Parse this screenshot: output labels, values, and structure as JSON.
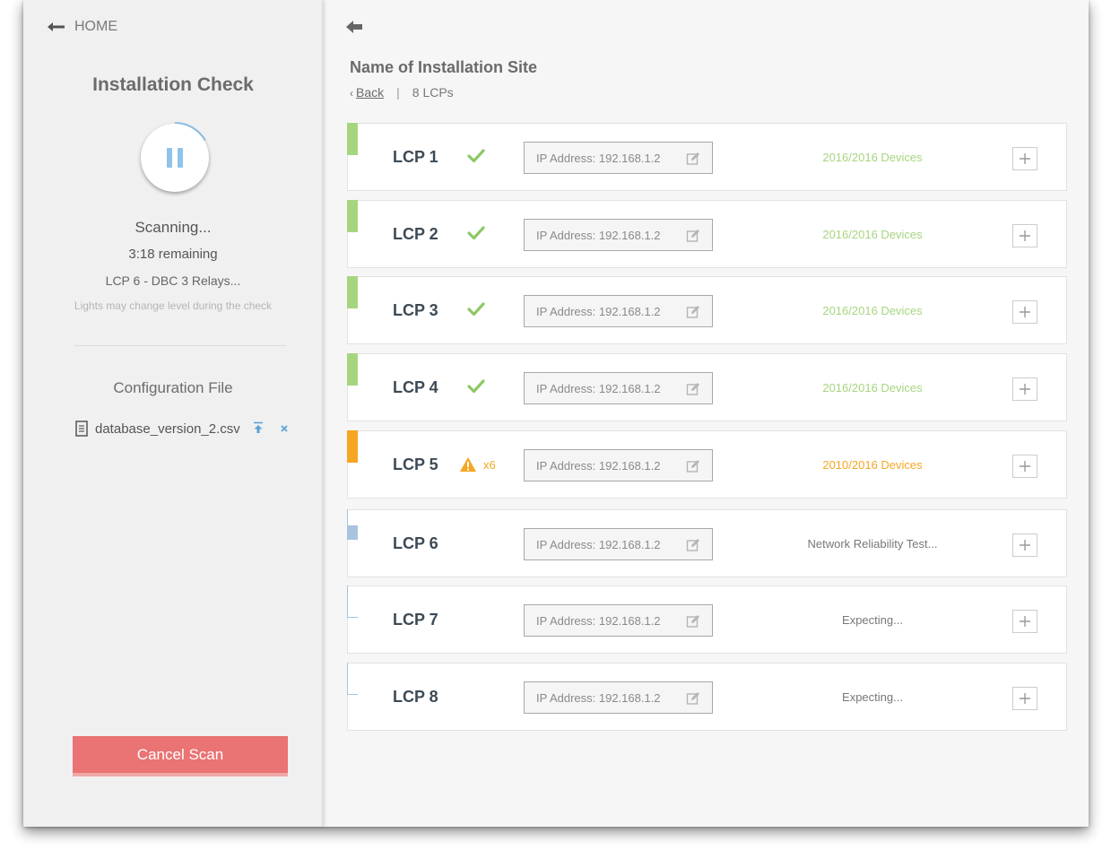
{
  "sidebar": {
    "home_label": "HOME",
    "title": "Installation Check",
    "scan_status": "Scanning...",
    "time_remaining": "3:18 remaining",
    "current_item": "LCP 6 - DBC 3 Relays...",
    "note": "Lights may change level during the check",
    "config_title": "Configuration File",
    "config_filename": "database_version_2.csv",
    "cancel_label": "Cancel Scan"
  },
  "main": {
    "site_name": "Name of Installation Site",
    "back_label": "Back",
    "lcp_count": "8 LCPs",
    "lcps": [
      {
        "name": "LCP 1",
        "state": "ok",
        "ip": "IP Address: 192.168.1.2",
        "status": "2016/2016 Devices"
      },
      {
        "name": "LCP 2",
        "state": "ok",
        "ip": "IP Address: 192.168.1.2",
        "status": "2016/2016 Devices"
      },
      {
        "name": "LCP 3",
        "state": "ok",
        "ip": "IP Address: 192.168.1.2",
        "status": "2016/2016 Devices"
      },
      {
        "name": "LCP 4",
        "state": "ok",
        "ip": "IP Address: 192.168.1.2",
        "status": "2016/2016 Devices"
      },
      {
        "name": "LCP 5",
        "state": "warning",
        "warning_count": "x6",
        "ip": "IP Address: 192.168.1.2",
        "status": "2010/2016 Devices"
      },
      {
        "name": "LCP 6",
        "state": "in-progress",
        "ip": "IP Address: 192.168.1.2",
        "status": "Network Reliability Test..."
      },
      {
        "name": "LCP 7",
        "state": "pending",
        "ip": "IP Address: 192.168.1.2",
        "status": "Expecting..."
      },
      {
        "name": "LCP 8",
        "state": "pending",
        "ip": "IP Address: 192.168.1.2",
        "status": "Expecting..."
      }
    ]
  },
  "colors": {
    "ok": "#a7d57f",
    "warning": "#f5a623",
    "in_progress": "#a9c3de",
    "cancel": "#ea7373",
    "accent_blue": "#8fc3ea"
  },
  "icons": {
    "home": "arrow-left-icon",
    "pause": "pause-icon",
    "file": "document-icon",
    "upload": "upload-icon",
    "remove": "close-icon",
    "check": "checkmark-icon",
    "warning": "warning-triangle-icon",
    "edit": "edit-icon",
    "expand": "plus-icon"
  }
}
